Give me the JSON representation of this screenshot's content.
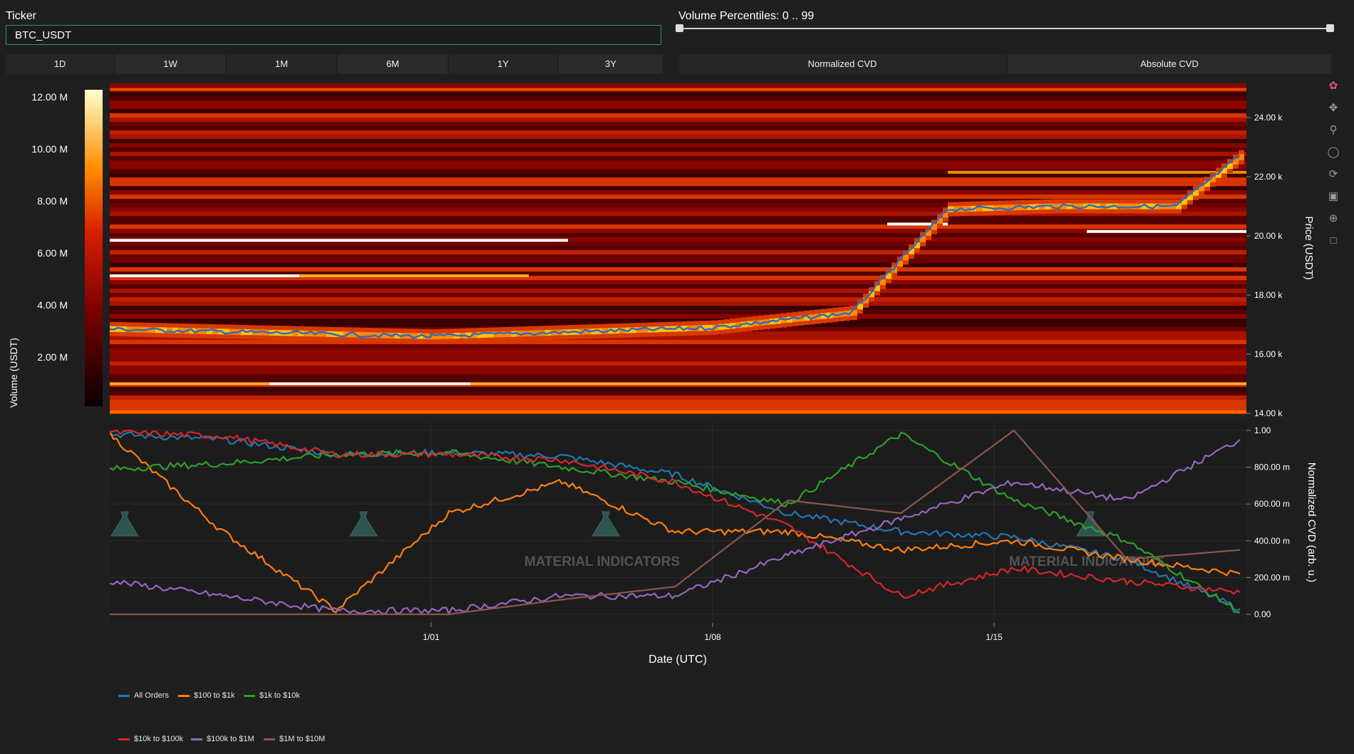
{
  "ticker": {
    "label": "Ticker",
    "value": "BTC_USDT"
  },
  "range_buttons": [
    "1D",
    "1W",
    "1M",
    "6M",
    "1Y",
    "3Y"
  ],
  "volume_percentiles": {
    "label": "Volume Percentiles: 0 .. 99",
    "low": 0,
    "high": 99
  },
  "cvd_buttons": [
    "Normalized CVD",
    "Absolute CVD"
  ],
  "heatmap": {
    "colorbar_ticks": [
      "12.00 M",
      "10.00 M",
      "8.00 M",
      "6.00 M",
      "4.00 M",
      "2.00 M"
    ],
    "colorbar_title": "Volume (USDT)",
    "price_ticks": [
      "24.00 k",
      "22.00 k",
      "20.00 k",
      "18.00 k",
      "16.00 k",
      "14.00 k"
    ],
    "price_title": "Price (USDT)"
  },
  "cvd": {
    "y_ticks": [
      "1.00",
      "800.00 m",
      "600.00 m",
      "400.00 m",
      "200.00 m",
      "0.00"
    ],
    "y_title": "Normalized CVD (arb. u.)",
    "x_ticks": [
      "1/01",
      "1/08",
      "1/15"
    ],
    "x_title": "Date (UTC)",
    "watermark": "MATERIAL INDICATORS"
  },
  "chart_data": {
    "type": "line",
    "x": [
      "12/24",
      "12/27",
      "12/30",
      "1/01",
      "1/04",
      "1/07",
      "1/10",
      "1/13",
      "1/16",
      "1/19",
      "1/22"
    ],
    "series": [
      {
        "name": "All Orders",
        "color": "#1f77b4",
        "values": [
          0.98,
          0.95,
          0.87,
          0.88,
          0.86,
          0.76,
          0.55,
          0.45,
          0.42,
          0.3,
          0.03
        ]
      },
      {
        "name": "$100 to $1k",
        "color": "#ff7f0e",
        "values": [
          0.98,
          0.45,
          0.02,
          0.55,
          0.72,
          0.45,
          0.45,
          0.35,
          0.4,
          0.3,
          0.22
        ]
      },
      {
        "name": "$1k to $10k",
        "color": "#2ca02c",
        "values": [
          0.79,
          0.82,
          0.87,
          0.88,
          0.8,
          0.72,
          0.6,
          0.98,
          0.62,
          0.4,
          0.01
        ]
      },
      {
        "name": "$10k to $100k",
        "color": "#d62728",
        "values": [
          0.99,
          0.97,
          0.87,
          0.87,
          0.84,
          0.72,
          0.48,
          0.1,
          0.25,
          0.18,
          0.12
        ]
      },
      {
        "name": "$100k to $1M",
        "color": "#9467bd",
        "values": [
          0.18,
          0.1,
          0.02,
          0.02,
          0.1,
          0.1,
          0.32,
          0.52,
          0.72,
          0.62,
          0.95
        ]
      },
      {
        "name": "$1M to $10M",
        "color": "#8c564b",
        "values": [
          0.0,
          0.0,
          0.0,
          0.0,
          0.08,
          0.15,
          0.62,
          0.55,
          1.0,
          0.3,
          0.35
        ]
      }
    ],
    "price_line": {
      "name": "Price",
      "x": [
        "12/24",
        "1/01",
        "1/08",
        "1/11",
        "1/14",
        "1/17",
        "1/20",
        "1/22"
      ],
      "values": [
        16850,
        16600,
        16900,
        17400,
        20900,
        21000,
        21000,
        22700
      ]
    }
  },
  "legend": {
    "row1": [
      "All Orders",
      "$100 to $1k",
      "$1k to $10k"
    ],
    "row2": [
      "$10k to $100k",
      "$100k to $1M",
      "$1M to $10M"
    ]
  },
  "modebar_icons": [
    "plotly-logo-icon",
    "pan-icon",
    "zoom-icon",
    "select-icon",
    "reset-icon",
    "save-icon",
    "crosshair-icon",
    "hover-icon"
  ]
}
